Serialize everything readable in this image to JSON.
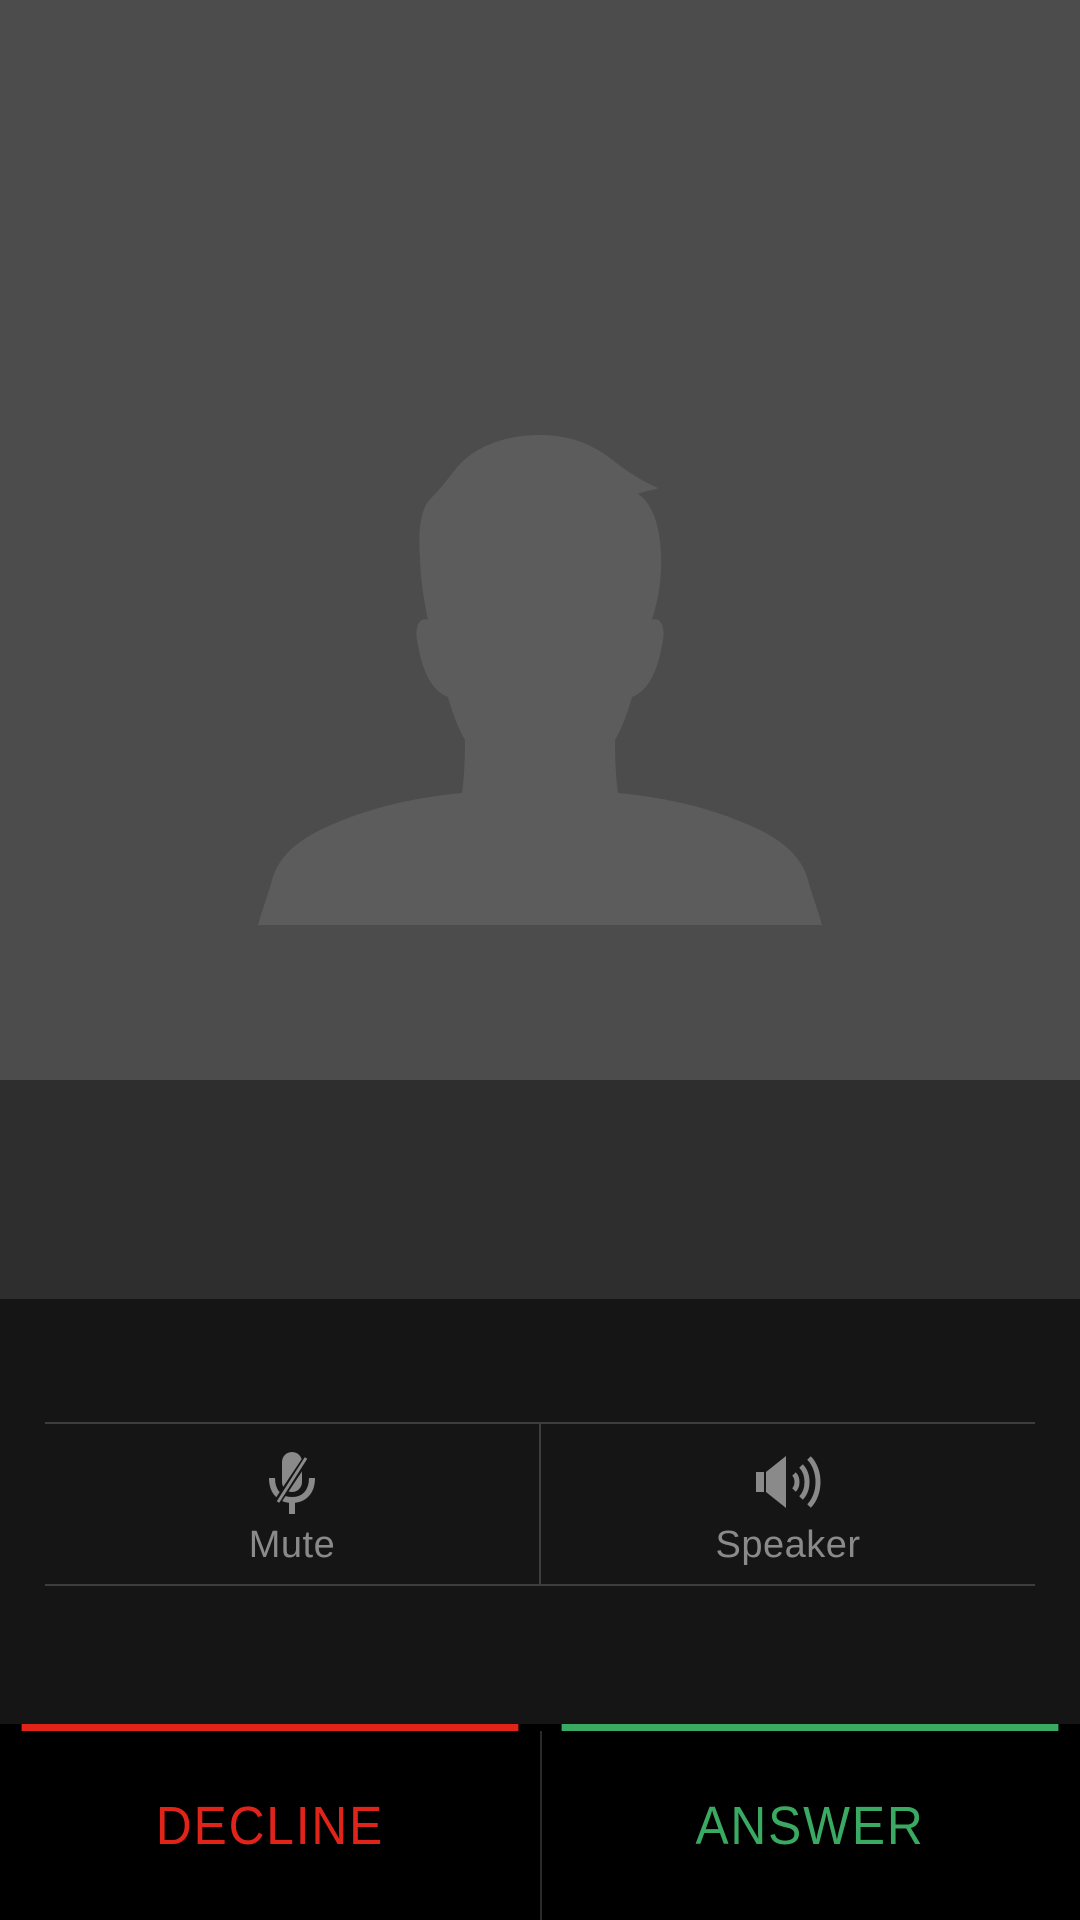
{
  "caller": {
    "avatar_icon": "person-silhouette-icon"
  },
  "controls": {
    "mute": {
      "label": "Mute",
      "icon": "mic-off-icon"
    },
    "speaker": {
      "label": "Speaker",
      "icon": "volume-up-icon"
    }
  },
  "actions": {
    "decline_label": "DECLINE",
    "answer_label": "ANSWER",
    "decline_color": "#e0241a",
    "answer_color": "#3aaa62"
  },
  "colors": {
    "photo_bg": "#4c4c4c",
    "info_band_bg": "#2e2e2e",
    "controls_bg": "#151515",
    "control_text": "#8a8a8a"
  }
}
